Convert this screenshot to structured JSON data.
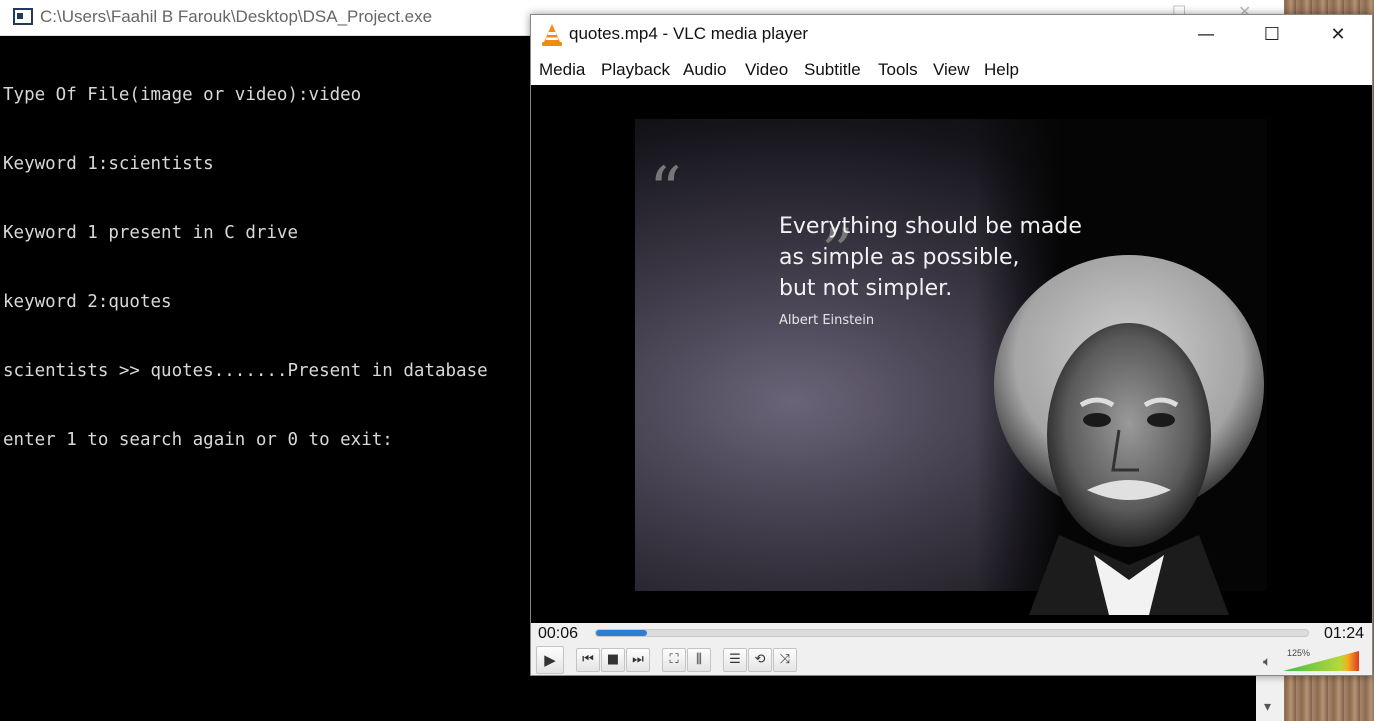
{
  "console": {
    "title": "C:\\Users\\Faahil B Farouk\\Desktop\\DSA_Project.exe",
    "lines": [
      "Type Of File(image or video):video",
      "Keyword 1:scientists",
      "Keyword 1 present in C drive",
      "keyword 2:quotes",
      "scientists >> quotes.......Present in database",
      "enter 1 to search again or 0 to exit:"
    ]
  },
  "vlc": {
    "title": "quotes.mp4 - VLC media player",
    "menu": [
      "Media",
      "Playback",
      "Audio",
      "Video",
      "Subtitle",
      "Tools",
      "View",
      "Help"
    ],
    "video": {
      "quote_lines": [
        "Everything should be made",
        "as simple as possible,",
        "but not simpler."
      ],
      "author": "Albert Einstein"
    },
    "elapsed": "00:06",
    "duration": "01:24",
    "progress_fraction": 0.071,
    "volume_label": "125%",
    "volume_fraction": 1.0,
    "accent_color": "#2d7fd6"
  },
  "icons": {
    "console_app": "console-app-icon",
    "vlc_app": "vlc-cone-icon",
    "minimize": "minimize-icon",
    "maximize": "maximize-icon",
    "close": "close-icon",
    "play": "play-icon",
    "previous": "previous-icon",
    "stop": "stop-icon",
    "next": "next-icon",
    "fullscreen": "fullscreen-icon",
    "extended_settings": "equalizer-icon",
    "playlist": "playlist-icon",
    "loop": "loop-icon",
    "shuffle": "shuffle-icon",
    "speaker": "speaker-icon"
  }
}
